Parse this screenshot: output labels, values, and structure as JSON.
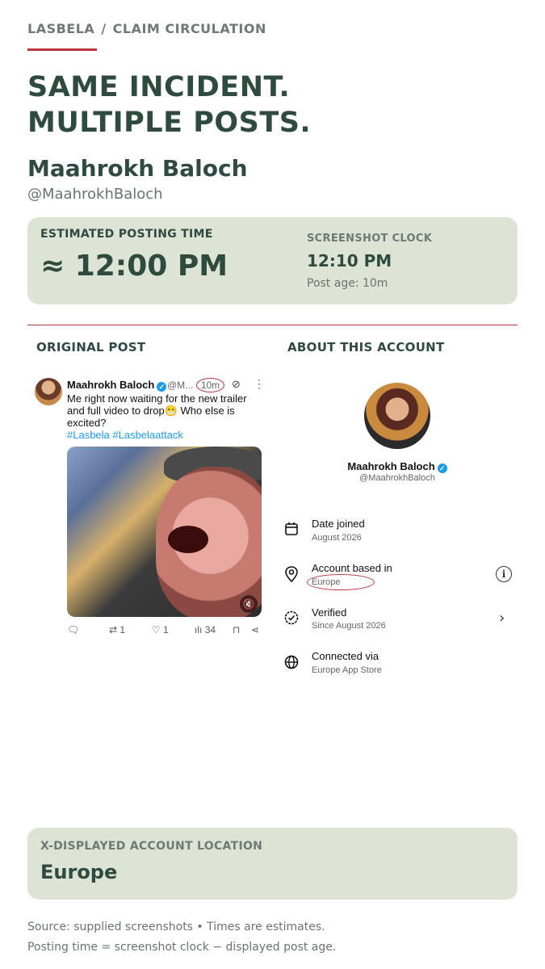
{
  "breadcrumb": {
    "brand": "LASBELA",
    "separator": "/",
    "section": "CLAIM CIRCULATION"
  },
  "headline": {
    "line1": "SAME INCIDENT.",
    "line2": "MULTIPLE POSTS."
  },
  "account": {
    "name": "Maahrokh Baloch",
    "handle": "@MaahrokhBaloch"
  },
  "timing": {
    "estimated_label": "ESTIMATED POSTING TIME",
    "estimated_value": "≈ 12:00 PM",
    "clock_label": "SCREENSHOT CLOCK",
    "clock_value": "12:10 PM",
    "post_age": "Post age: 10m"
  },
  "columns": {
    "left_title": "ORIGINAL POST",
    "right_title": "ABOUT THIS ACCOUNT"
  },
  "tweet": {
    "author": "Maahrokh Baloch",
    "handle_short": "@M...",
    "time": "10m",
    "text": "Me right now waiting for the new trailer and full video to drop😁 Who else is excited?",
    "hashtags": "#Lasbela #Lasbelaattack",
    "replies": "",
    "retweets": "1",
    "likes": "1",
    "views": "34"
  },
  "about": {
    "name": "Maahrokh Baloch",
    "handle": "@MaahrokhBaloch",
    "rows": [
      {
        "title": "Date joined",
        "value": "August 2026",
        "icon": "calendar-icon"
      },
      {
        "title": "Account based in",
        "value": "Europe",
        "icon": "location-pin-icon"
      },
      {
        "title": "Verified",
        "value": "Since August 2026",
        "icon": "verified-badge-icon"
      },
      {
        "title": "Connected via",
        "value": "Europe App Store",
        "icon": "globe-icon"
      }
    ]
  },
  "location_card": {
    "label": "X-DISPLAYED ACCOUNT LOCATION",
    "value": "Europe"
  },
  "footer": {
    "line1": "Source: supplied screenshots • Times are estimates.",
    "line2": "Posting time = screenshot clock − displayed post age."
  },
  "colors": {
    "accent_red": "#b8363c",
    "dark_green": "#2f4a3f",
    "card_bg": "#dde3d5",
    "link_blue": "#1d9bf0"
  }
}
